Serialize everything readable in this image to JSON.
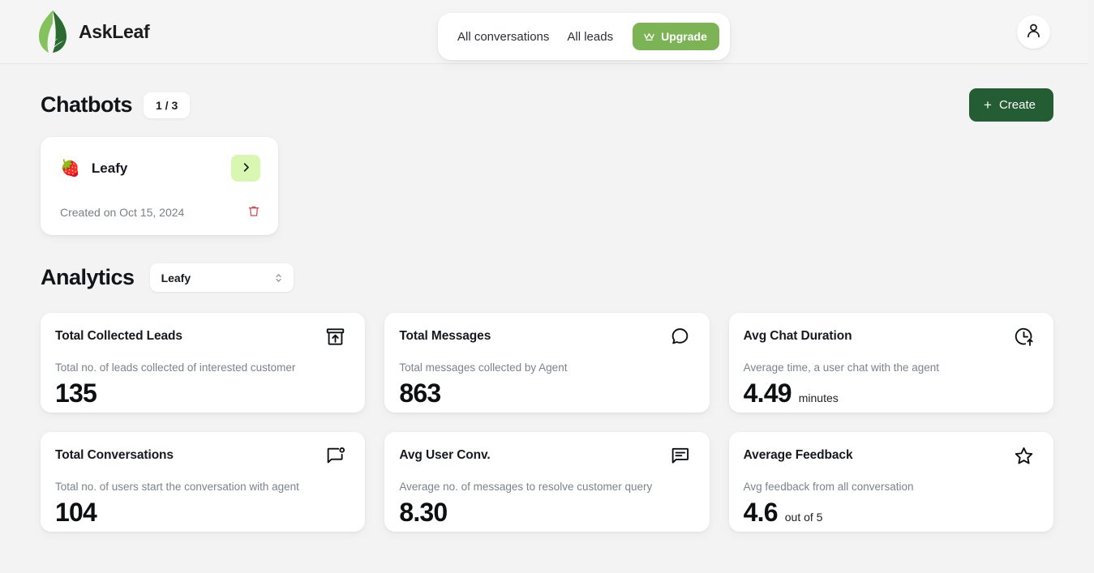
{
  "brand": {
    "name": "AskLeaf",
    "logo_icon": "leaf-logo"
  },
  "header": {
    "nav": [
      {
        "label": "All conversations",
        "name": "all-conversations"
      },
      {
        "label": "All leads",
        "name": "all-leads"
      }
    ],
    "upgrade": {
      "label": "Upgrade",
      "icon": "crown-icon",
      "color": "#7cb354"
    },
    "avatar_icon": "user-icon"
  },
  "chatbots": {
    "title": "Chatbots",
    "count_badge": "1 / 3",
    "create_label": "Create",
    "create_icon": "plus-icon",
    "create_color": "#245c33",
    "cards": [
      {
        "emoji": "🍓",
        "name": "Leafy",
        "created": "Created on Oct 15, 2024",
        "open_icon": "chevron-right-icon",
        "open_color": "#d9f7b0",
        "delete_icon": "trash-icon",
        "delete_color": "#c9444e"
      }
    ]
  },
  "analytics": {
    "title": "Analytics",
    "selected_bot": "Leafy",
    "select_icon": "chevron-up-down-icon",
    "metrics": [
      {
        "title": "Total Collected Leads",
        "description": "Total no. of leads collected of interested customer",
        "value": "135",
        "unit": "",
        "icon": "archive-upload-icon"
      },
      {
        "title": "Total Messages",
        "description": "Total messages collected by Agent",
        "value": "863",
        "unit": "",
        "icon": "speech-bubble-icon"
      },
      {
        "title": "Avg Chat Duration",
        "description": "Average time, a user chat with the agent",
        "value": "4.49",
        "unit": "minutes",
        "icon": "clock-arrow-up-icon"
      },
      {
        "title": "Total Conversations",
        "description": "Total no. of users start the conversation with agent",
        "value": "104",
        "unit": "",
        "icon": "message-dot-icon"
      },
      {
        "title": "Avg User Conv.",
        "description": "Average no. of messages to resolve customer query",
        "value": "8.30",
        "unit": "",
        "icon": "message-lines-icon"
      },
      {
        "title": "Average Feedback",
        "description": "Avg feedback from all conversation",
        "value": "4.6",
        "unit": "out of 5",
        "icon": "star-icon"
      }
    ]
  }
}
